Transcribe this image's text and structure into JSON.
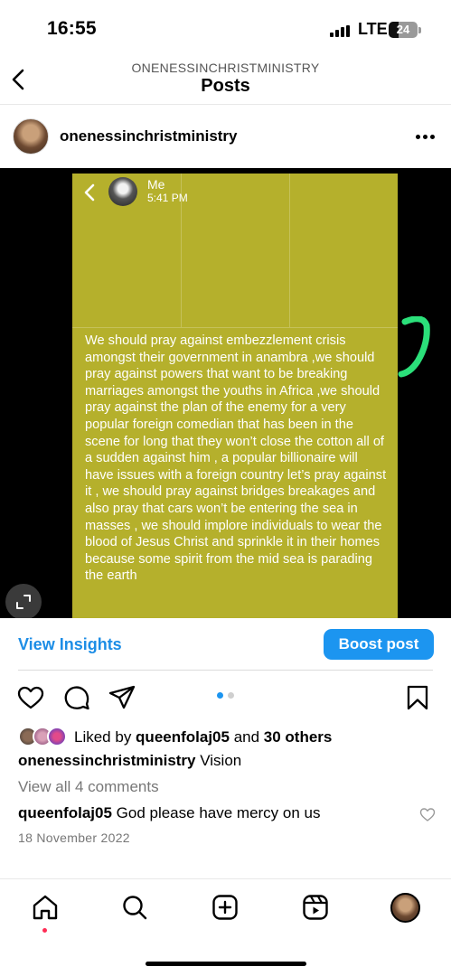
{
  "status_bar": {
    "time": "16:55",
    "network": "LTE",
    "battery": "24"
  },
  "header": {
    "account": "ONENESSINCHRISTMINISTRY",
    "title": "Posts"
  },
  "post": {
    "author": "onenessinchristministry",
    "image": {
      "chat_contact": "Me",
      "chat_time": "5:41 PM",
      "message": "We should pray against embezzlement crisis amongst their government in anambra ,we should pray against powers that want to be breaking marriages amongst the youths in Africa ,we should pray against the plan of the enemy for a very popular foreign comedian that has been in the scene for long that they won’t close the cotton all of a sudden against him , a popular billionaire will have issues with a foreign country let’s pray against it , we should pray against bridges breakages and also pray that cars won’t be entering the sea in masses ,  we should implore individuals to wear the blood of Jesus Christ and sprinkle it in their homes because some spirit from the mid sea is parading the earth",
      "panel_color": "#b5b02c"
    },
    "actions": {
      "view_insights": "View Insights",
      "boost": "Boost post"
    },
    "carousel": {
      "count": 2,
      "active_index": 0
    },
    "likes": {
      "prefix": "Liked by ",
      "user": "queenfolaj05",
      "middle": " and ",
      "others": "30 others"
    },
    "caption": {
      "user": "onenessinchristministry",
      "text": " Vision"
    },
    "view_comments": "View all 4 comments",
    "comment": {
      "user": "queenfolaj05",
      "text": " God please have mercy on us"
    },
    "date": "18 November 2022"
  },
  "colors": {
    "accent": "#1c95f0",
    "link": "#1c8de6",
    "notification": "#ff2d55"
  },
  "icons": {
    "actions": [
      "heart-icon",
      "comment-icon",
      "share-icon",
      "bookmark-icon"
    ],
    "nav": [
      "home-icon",
      "search-icon",
      "create-icon",
      "reels-icon",
      "profile-avatar"
    ]
  }
}
